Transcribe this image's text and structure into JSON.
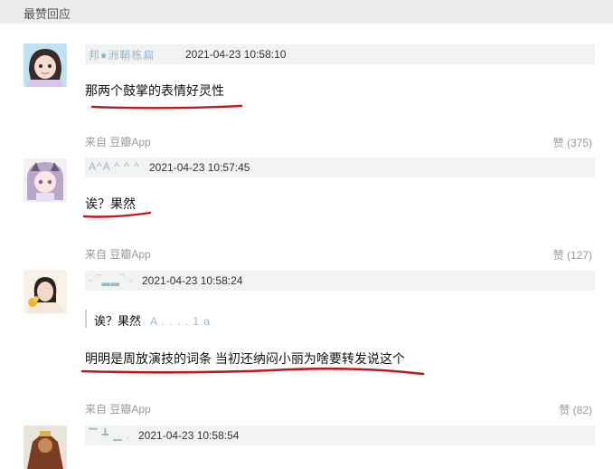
{
  "section": {
    "title": "最赞回应"
  },
  "comments": [
    {
      "username": "邦●洲鞘栋扁",
      "time": "2021-04-23 10:58:10",
      "text": "那两个鼓掌的表情好灵性",
      "source": "来自 豆瓣App",
      "likes": "赞 (375)"
    },
    {
      "username": "A^A ^ ^ ^ ",
      "time": "2021-04-23 10:57:45",
      "text": "诶？果然",
      "source": "来自 豆瓣App",
      "likes": "赞 (127)"
    },
    {
      "username": "· ‾▂▂‾ ·",
      "time": "2021-04-23 10:58:24",
      "quote_text": "诶？果然",
      "quote_user": "A . . . . 1 a",
      "text": "明明是周放演技的词条 当初还纳闷小丽为啥要转发说这个",
      "source": "来自 豆瓣App",
      "likes": "赞 (82)"
    },
    {
      "username": "▔ ┻ ▁ .",
      "time": "2021-04-23 10:58:54"
    }
  ],
  "colors": {
    "annotation": "#c0161e",
    "meta_bg": "#f0f3f1",
    "header_bg": "#ececec"
  }
}
